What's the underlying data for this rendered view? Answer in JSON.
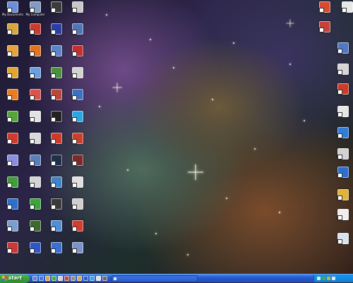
{
  "desktop": {
    "wallpaper": "nebula-wallpaper",
    "icons_left": [
      {
        "name": "my-documents-icon",
        "label": "My Documents",
        "color": "#6a8fd8"
      },
      {
        "name": "my-computer-icon",
        "label": "My Computer",
        "color": "#7f9bc2"
      },
      {
        "name": "app-icon-03",
        "label": "",
        "color": "#3b3b3b"
      },
      {
        "name": "app-icon-04",
        "label": "",
        "color": "#c9c9c9"
      },
      {
        "name": "app-icon-05",
        "label": "",
        "color": "#d9a53f"
      },
      {
        "name": "app-icon-06",
        "label": "",
        "color": "#cc3b2b"
      },
      {
        "name": "app-icon-07",
        "label": "",
        "color": "#2a3ea8"
      },
      {
        "name": "app-icon-08",
        "label": "",
        "color": "#4f77b8"
      },
      {
        "name": "app-icon-09",
        "label": "",
        "color": "#e2a43b"
      },
      {
        "name": "firefox-icon",
        "label": "",
        "color": "#e2741f"
      },
      {
        "name": "app-icon-11",
        "label": "",
        "color": "#5a86c7"
      },
      {
        "name": "app-icon-12",
        "label": "",
        "color": "#c23030"
      },
      {
        "name": "app-icon-13",
        "label": "",
        "color": "#e0a634"
      },
      {
        "name": "app-icon-14",
        "label": "",
        "color": "#6b9fe0"
      },
      {
        "name": "app-icon-15",
        "label": "",
        "color": "#4b8f3f"
      },
      {
        "name": "app-icon-16",
        "label": "",
        "color": "#d2d2d2"
      },
      {
        "name": "app-icon-17",
        "label": "",
        "color": "#e77d25"
      },
      {
        "name": "app-icon-18",
        "label": "",
        "color": "#d9544a"
      },
      {
        "name": "app-icon-19",
        "label": "",
        "color": "#b8483a"
      },
      {
        "name": "app-icon-20",
        "label": "",
        "color": "#3d6fc2"
      },
      {
        "name": "app-icon-21",
        "label": "",
        "color": "#55a53c"
      },
      {
        "name": "app-icon-22",
        "label": "",
        "color": "#e2e2e2"
      },
      {
        "name": "app-icon-23",
        "label": "",
        "color": "#222222"
      },
      {
        "name": "skype-icon",
        "label": "",
        "color": "#2aa7e2"
      },
      {
        "name": "app-icon-25",
        "label": "",
        "color": "#d13a2e"
      },
      {
        "name": "app-icon-26",
        "label": "",
        "color": "#d9d9d9"
      },
      {
        "name": "app-icon-27",
        "label": "",
        "color": "#cc3a2a"
      },
      {
        "name": "app-icon-28",
        "label": "",
        "color": "#c9402c"
      },
      {
        "name": "app-icon-29",
        "label": "",
        "color": "#8a8ee0"
      },
      {
        "name": "app-icon-30",
        "label": "",
        "color": "#5b7fb8"
      },
      {
        "name": "app-icon-31",
        "label": "",
        "color": "#1f2f4a"
      },
      {
        "name": "app-icon-32",
        "label": "",
        "color": "#7a2a2a"
      },
      {
        "name": "app-icon-33",
        "label": "",
        "color": "#3f9e3a"
      },
      {
        "name": "app-icon-34",
        "label": "",
        "color": "#d4d4d4"
      },
      {
        "name": "app-icon-35",
        "label": "",
        "color": "#3f84c9"
      },
      {
        "name": "app-icon-36",
        "label": "",
        "color": "#e0e0e0"
      },
      {
        "name": "app-icon-37",
        "label": "",
        "color": "#2f6fc9"
      },
      {
        "name": "app-icon-38",
        "label": "",
        "color": "#3da33a"
      },
      {
        "name": "app-icon-39",
        "label": "",
        "color": "#3a3a3a"
      },
      {
        "name": "app-icon-40",
        "label": "",
        "color": "#cfcfcf"
      },
      {
        "name": "app-icon-41",
        "label": "",
        "color": "#7a9fcf"
      },
      {
        "name": "app-icon-42",
        "label": "",
        "color": "#3c6b2f"
      },
      {
        "name": "app-icon-43",
        "label": "",
        "color": "#4f8fd8"
      },
      {
        "name": "app-icon-44",
        "label": "",
        "color": "#d23d2f"
      },
      {
        "name": "app-icon-45",
        "label": "",
        "color": "#c83a3a"
      },
      {
        "name": "app-icon-46",
        "label": "",
        "color": "#2f58c4"
      },
      {
        "name": "app-icon-47",
        "label": "",
        "color": "#3b6fd0"
      },
      {
        "name": "app-icon-48",
        "label": "",
        "color": "#7b93c8"
      },
      {
        "name": "app-icon-49",
        "label": "",
        "color": "#9a9a9a"
      },
      {
        "name": "app-icon-50",
        "label": "",
        "color": "#3355b0"
      }
    ],
    "icons_right": [
      {
        "name": "app-icon-r01",
        "label": "",
        "color": "#d94b2f"
      },
      {
        "name": "app-icon-r02",
        "label": "",
        "color": "#e8e8e8"
      },
      {
        "name": "app-icon-r03",
        "label": "",
        "color": "#c7413a"
      },
      {
        "name": "app-icon-r04",
        "label": "",
        "color": "#5278c4"
      },
      {
        "name": "app-icon-r05",
        "label": "",
        "color": "#d6d6d6"
      },
      {
        "name": "app-icon-r06",
        "label": "",
        "color": "#cc3b2b"
      },
      {
        "name": "app-icon-r07",
        "label": "",
        "color": "#e6e6e6"
      },
      {
        "name": "app-icon-r08",
        "label": "",
        "color": "#2f7fd8"
      },
      {
        "name": "app-icon-r09",
        "label": "",
        "color": "#d2d2d2"
      },
      {
        "name": "app-icon-r10",
        "label": "",
        "color": "#2d6fd1"
      },
      {
        "name": "app-icon-r11",
        "label": "",
        "color": "#e0b33a"
      },
      {
        "name": "app-icon-r12",
        "label": "",
        "color": "#eeeeee"
      },
      {
        "name": "recycle-bin-icon",
        "label": "",
        "color": "#d8e3f0"
      }
    ]
  },
  "taskbar": {
    "start_label": "start",
    "quicklaunch": [
      {
        "name": "show-desktop-icon",
        "color": "#5d87c9"
      },
      {
        "name": "browser-icon",
        "color": "#3b7be0"
      },
      {
        "name": "quicklaunch-app-3",
        "color": "#e3a13a"
      },
      {
        "name": "quicklaunch-app-4",
        "color": "#48a84a"
      },
      {
        "name": "quicklaunch-app-5",
        "color": "#d2d2d2"
      },
      {
        "name": "quicklaunch-app-6",
        "color": "#c84b35"
      },
      {
        "name": "quicklaunch-app-7",
        "color": "#8e8e8e"
      },
      {
        "name": "quicklaunch-app-8",
        "color": "#d9a44a"
      },
      {
        "name": "quicklaunch-app-9",
        "color": "#2f5fc4"
      },
      {
        "name": "quicklaunch-app-10",
        "color": "#3da0e0"
      },
      {
        "name": "quicklaunch-app-11",
        "color": "#e0e0e0"
      },
      {
        "name": "quicklaunch-app-12",
        "color": "#6b6b6b"
      }
    ],
    "task_label": "",
    "tray_icons": [
      {
        "name": "tray-icon-1",
        "color": "#e8e8e8"
      },
      {
        "name": "tray-icon-2",
        "color": "#3fb04a"
      },
      {
        "name": "tray-icon-3",
        "color": "#d9a43a"
      },
      {
        "name": "volume-icon",
        "color": "#dde7f5"
      }
    ],
    "clock": ""
  }
}
